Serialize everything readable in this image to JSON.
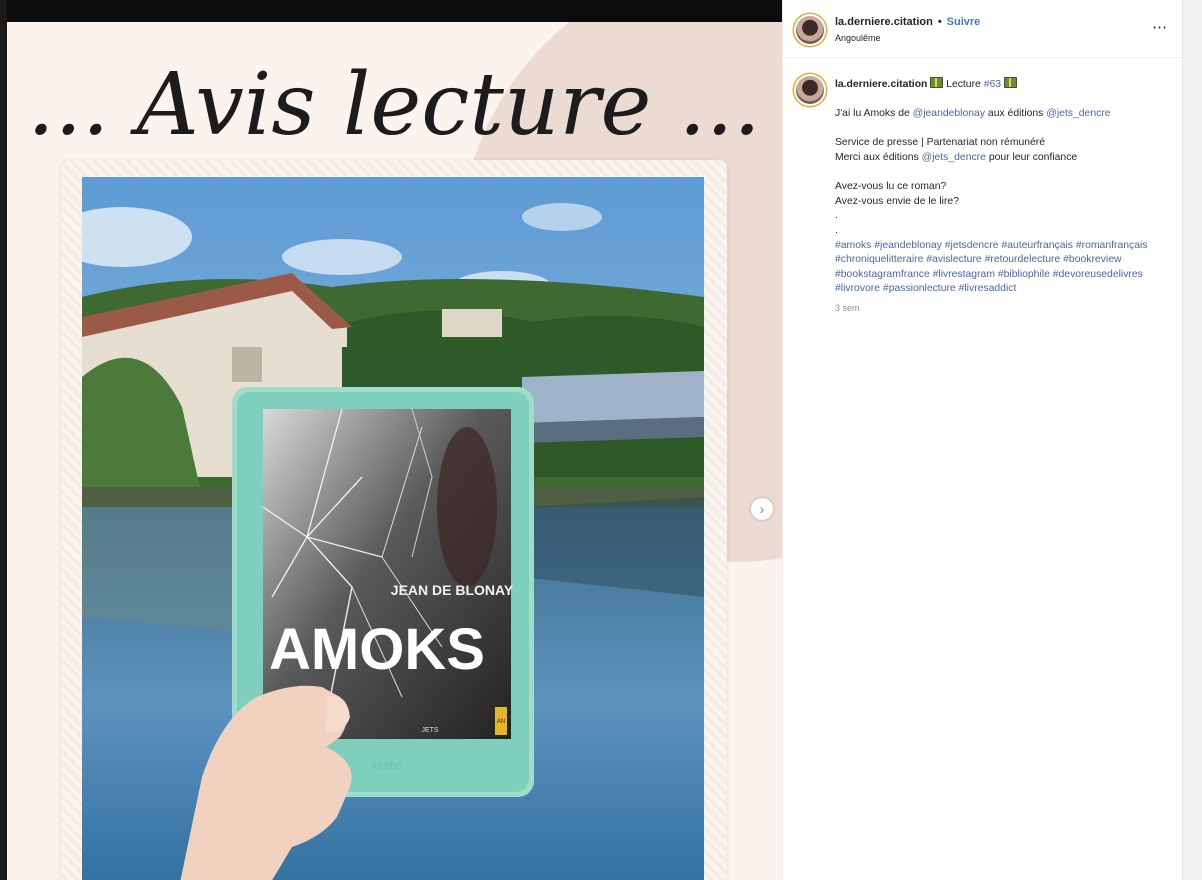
{
  "post_image": {
    "headline": "... Avis lecture ...",
    "cover_author": "JEAN DE BLONAY",
    "cover_title": "AMOKS",
    "cover_publisher": "JETS",
    "cover_spine": "AN",
    "device_brand": "kindle"
  },
  "header": {
    "username": "la.derniere.citation",
    "separator": "•",
    "follow_label": "Suivre",
    "location": "Angoulême",
    "more_icon": "⋯"
  },
  "caption": {
    "username": "la.derniere.citation",
    "lecture_word": "Lecture",
    "lecture_tag": "#63",
    "line1_pre": "J'ai lu Amoks de",
    "line1_mention1": "@jeandeblonay",
    "line1_mid": "aux éditions",
    "line1_mention2": "@jets_dencre",
    "line2": "Service de presse | Partenariat non rémunéré",
    "line3_pre": "Merci aux éditions",
    "line3_mention": "@jets_dencre",
    "line3_post": "pour leur confiance",
    "line4": "Avez-vous lu ce roman?",
    "line5": "Avez-vous envie de le lire?",
    "dot1": ".",
    "dot2": ".",
    "hashtags_line1": "#amoks #jeandeblonay #jetsdencre #auteurfrançais #romanfrançais",
    "hashtags_line2": "#chroniquelitteraire #avislecture #retourdelecture #bookreview",
    "hashtags_line3": "#bookstagramfrance #livrestagram #bibliophile #devoreusedelivres",
    "hashtags_line4": "#livrovore #passionlecture #livresaddict",
    "time": "3 sem"
  },
  "nav": {
    "next_icon": "›"
  }
}
